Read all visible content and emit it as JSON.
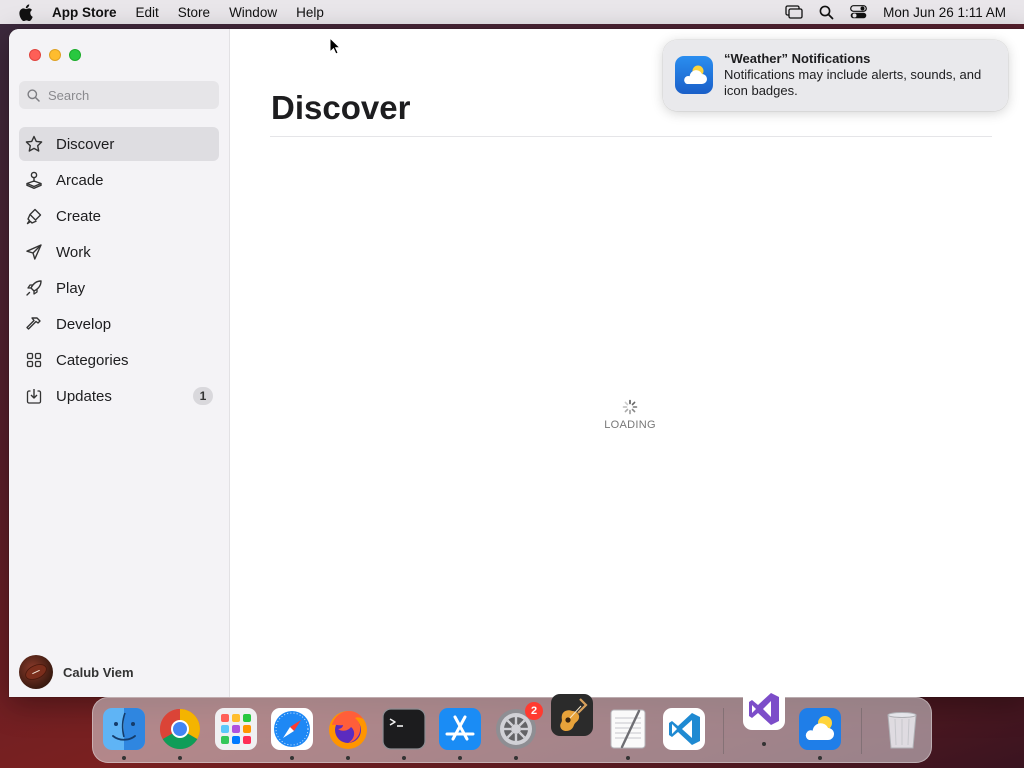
{
  "menubar": {
    "app_name": "App Store",
    "items": [
      "Edit",
      "Store",
      "Window",
      "Help"
    ],
    "clock": "Mon Jun 26  1:11 AM"
  },
  "sidebar": {
    "search_placeholder": "Search",
    "items": [
      {
        "label": "Discover",
        "icon": "star-icon",
        "active": true
      },
      {
        "label": "Arcade",
        "icon": "joystick-icon"
      },
      {
        "label": "Create",
        "icon": "brush-icon"
      },
      {
        "label": "Work",
        "icon": "paper-plane-icon"
      },
      {
        "label": "Play",
        "icon": "rocket-icon"
      },
      {
        "label": "Develop",
        "icon": "hammer-icon"
      },
      {
        "label": "Categories",
        "icon": "grid-icon"
      },
      {
        "label": "Updates",
        "icon": "download-icon",
        "badge": "1"
      }
    ],
    "account_name": "Calub Viem"
  },
  "main": {
    "title": "Discover",
    "loading_text": "LOADING"
  },
  "notification": {
    "title": "“Weather” Notifications",
    "body": "Notifications may include alerts, sounds, and icon badges."
  },
  "dock": {
    "items": [
      {
        "name": "finder",
        "running": true
      },
      {
        "name": "chrome",
        "running": true
      },
      {
        "name": "launchpad",
        "running": false
      },
      {
        "name": "safari",
        "running": true
      },
      {
        "name": "firefox",
        "running": true
      },
      {
        "name": "terminal",
        "running": true
      },
      {
        "name": "app-store",
        "running": true
      },
      {
        "name": "system-settings",
        "running": true,
        "badge": "2"
      },
      {
        "name": "garageband",
        "running": false
      },
      {
        "name": "textedit",
        "running": true
      },
      {
        "name": "vscode",
        "running": false
      },
      {
        "name": "visual-studio",
        "running": true
      },
      {
        "name": "weather",
        "running": true
      },
      {
        "name": "trash",
        "running": false
      }
    ]
  },
  "colors": {
    "accent": "#007aff",
    "sidebar_bg": "#f4f3f6",
    "active_item_bg": "#dedde1"
  }
}
